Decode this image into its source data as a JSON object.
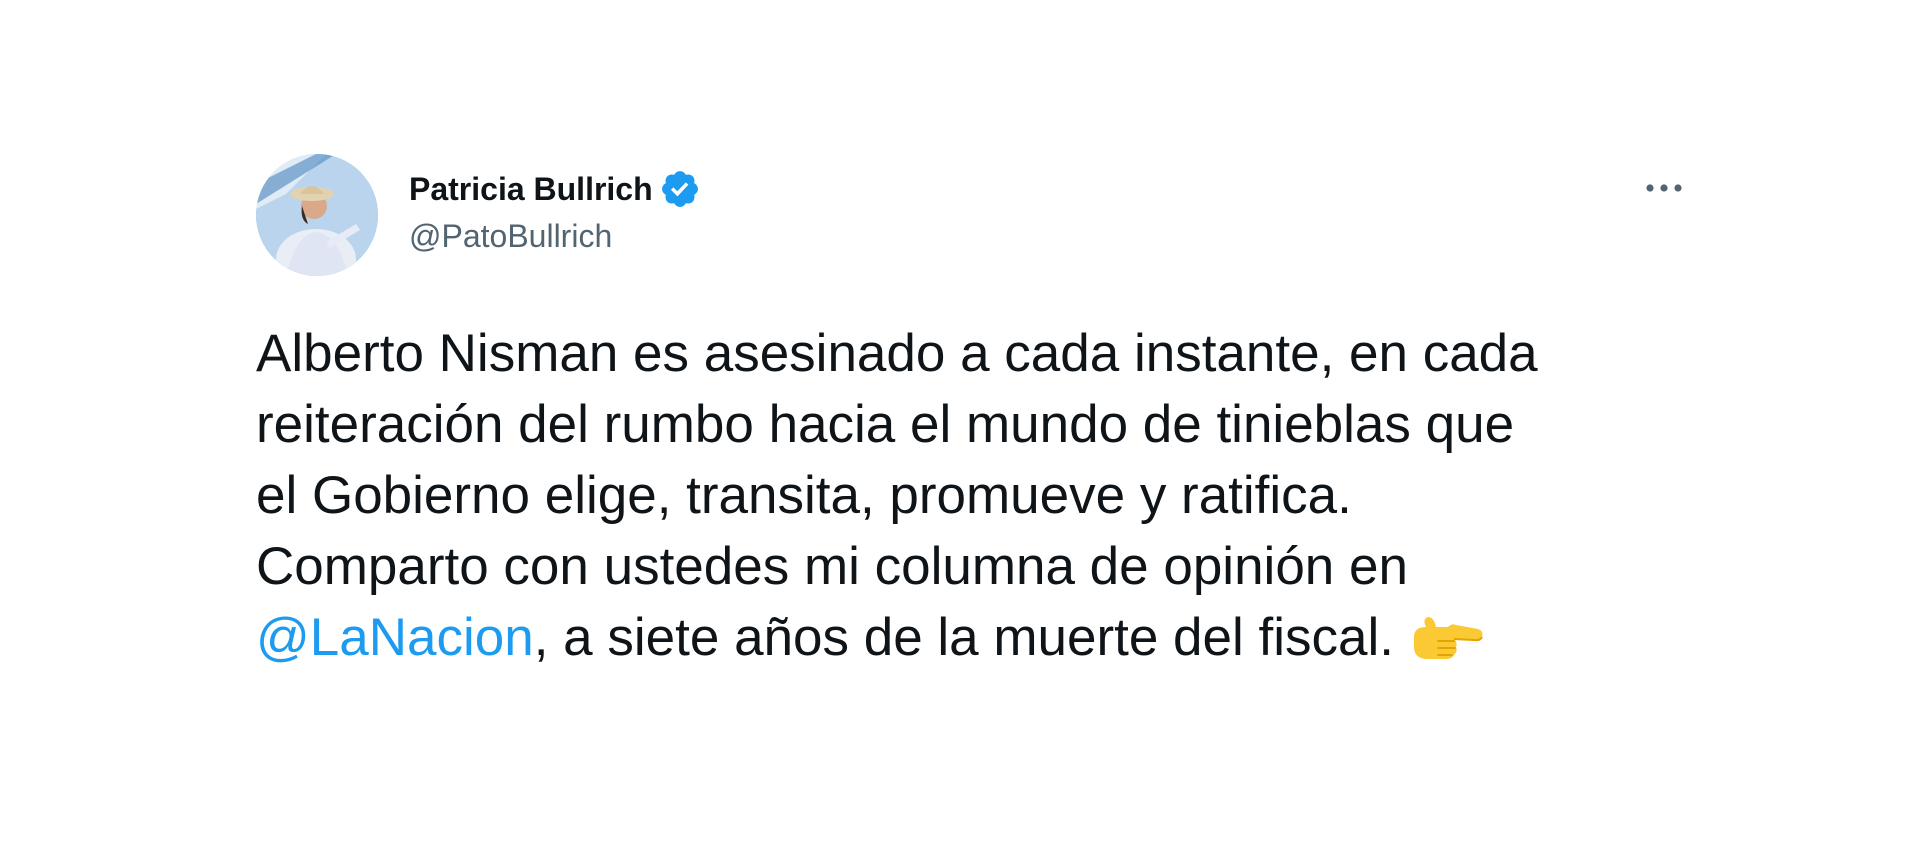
{
  "tweet": {
    "author": {
      "display_name": "Patricia Bullrich",
      "handle": "@PatoBullrich",
      "verified": true,
      "avatar_icon": "profile-photo"
    },
    "more_icon": "more-dots-icon",
    "text": {
      "line1": "Alberto Nisman es asesinado a cada instante, en cada",
      "line2": "reiteración del rumbo hacia el mundo de tinieblas que",
      "line3": "el Gobierno elige, transita, promueve y ratifica.",
      "line4": "Comparto con ustedes mi columna de opinión en",
      "mention": "@LaNacion",
      "line5_rest": ", a siete años de la muerte del fiscal.",
      "emoji": "backhand-index-pointing-right-icon"
    },
    "colors": {
      "text": "#0f1419",
      "secondary": "#536471",
      "link": "#1d9bf0",
      "verified": "#1d9bf0"
    }
  }
}
